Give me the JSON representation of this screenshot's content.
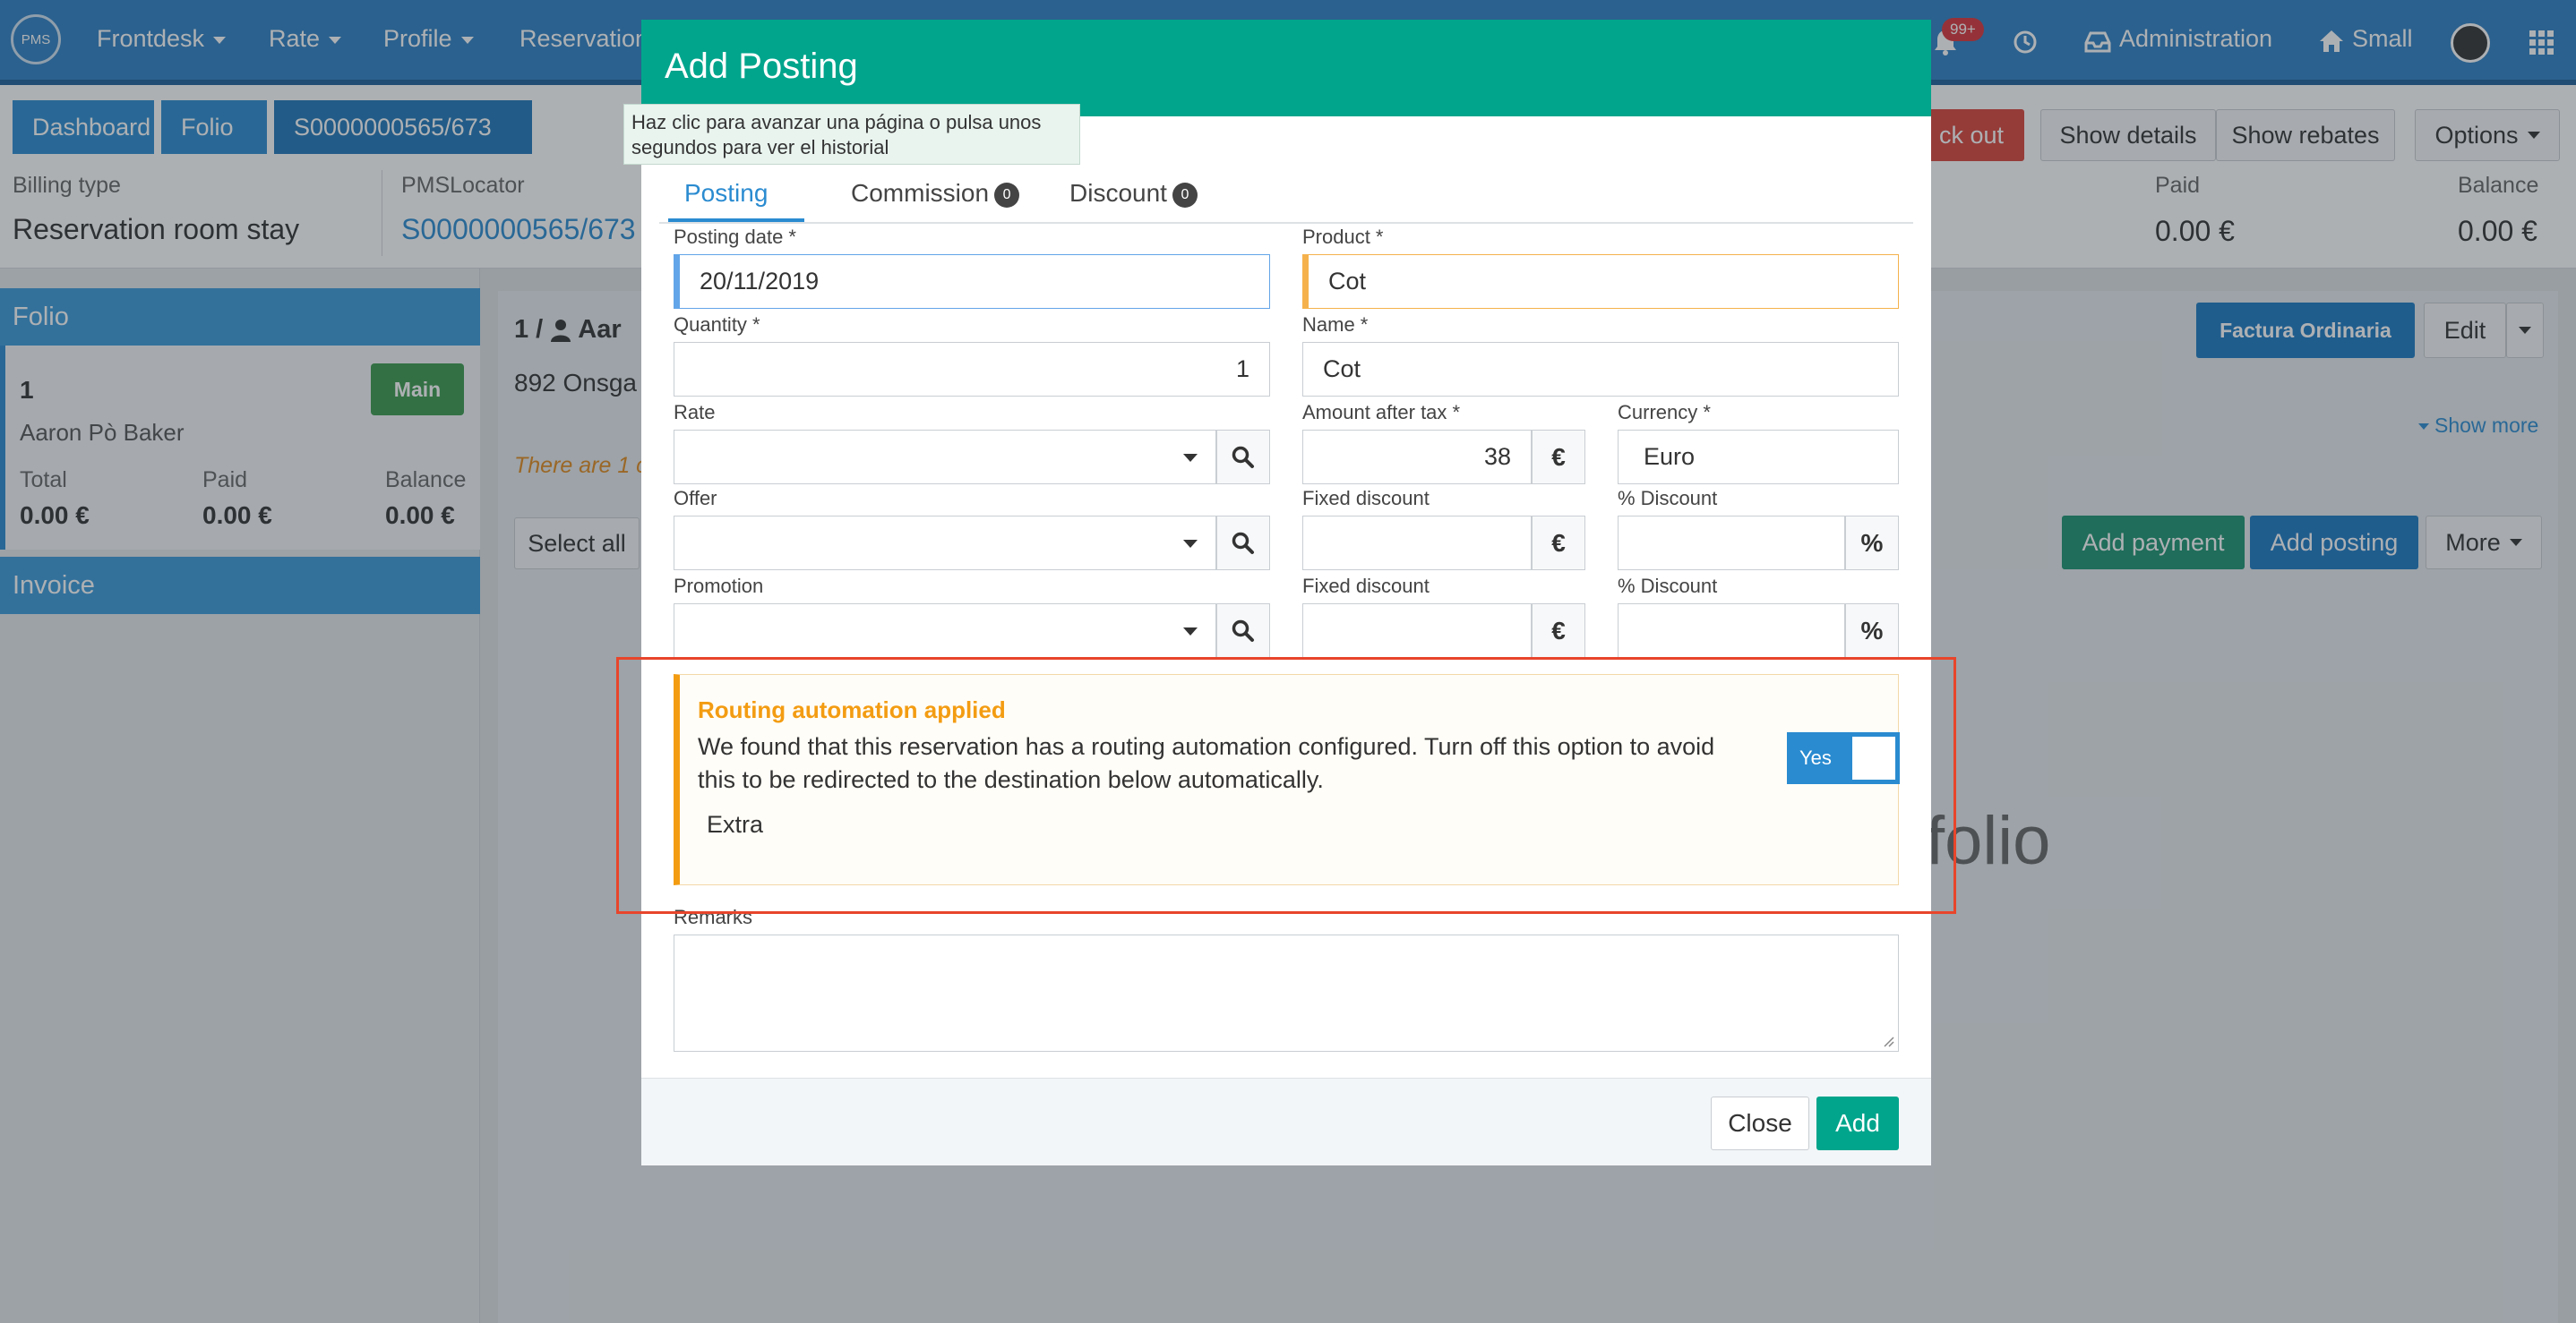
{
  "nav": {
    "logo_text": "PMS",
    "items": [
      {
        "label": "Frontdesk"
      },
      {
        "label": "Rate"
      },
      {
        "label": "Profile"
      },
      {
        "label": "Reservation"
      }
    ],
    "notifications_badge": "99+",
    "administration": "Administration",
    "small": "Small"
  },
  "breadcrumb": {
    "dashboard": "Dashboard",
    "folio": "Folio",
    "locator": "S0000000565/673"
  },
  "tooltip": "Haz clic para avanzar una página o pulsa unos segundos para ver el historial",
  "header_actions": {
    "checkout": "ck out",
    "show_details": "Show details",
    "show_rebates": "Show rebates",
    "options": "Options"
  },
  "billing": {
    "billing_type_label": "Billing type",
    "billing_type_value": "Reservation room stay",
    "pms_locator_label": "PMSLocator",
    "pms_locator_value": "S0000000565/673",
    "paid_label": "Paid",
    "paid_value": "0.00 €",
    "balance_label": "Balance",
    "balance_value": "0.00 €"
  },
  "sidebar": {
    "folio_header": "Folio",
    "folio_number": "1",
    "main_badge": "Main",
    "guest_name": "Aaron Pò Baker",
    "total_label": "Total",
    "total_value": "0.00 €",
    "paid_label": "Paid",
    "paid_value": "0.00 €",
    "balance_label": "Balance",
    "balance_value": "0.00 €",
    "invoice_header": "Invoice"
  },
  "main": {
    "folio_title": "1 / ",
    "guest_short": "Aar",
    "address_short": "892 Onsga",
    "warning_short": "There are 1 c",
    "factura_button": "Factura Ordinaria",
    "edit_button": "Edit",
    "show_more": "Show more",
    "select_all": "Select all",
    "add_payment": "Add payment",
    "add_posting": "Add posting",
    "more": "More",
    "empty_folio_text": "folio"
  },
  "modal": {
    "title": "Add Posting",
    "tabs": [
      {
        "label": "Posting",
        "count": ""
      },
      {
        "label": "Commission",
        "count": "0"
      },
      {
        "label": "Discount",
        "count": "0"
      }
    ],
    "posting_date_label": "Posting date *",
    "posting_date_value": "20/11/2019",
    "product_label": "Product *",
    "product_value": "Cot",
    "quantity_label": "Quantity *",
    "quantity_value": "1",
    "name_label": "Name *",
    "name_value": "Cot",
    "rate_label": "Rate",
    "amount_label": "Amount after tax *",
    "amount_value": "38",
    "currency_symbol": "€",
    "currency_label": "Currency *",
    "currency_value": "Euro",
    "offer_label": "Offer",
    "fixed_discount_label": "Fixed discount",
    "percent_discount_label": "% Discount",
    "percent_symbol": "%",
    "promotion_label": "Promotion",
    "routing": {
      "title": "Routing automation applied",
      "text": "We found that this reservation has a routing automation configured. Turn off this option to avoid this to be redirected to the destination below automatically.",
      "destination": "Extra",
      "toggle_label": "Yes",
      "toggle_on": true
    },
    "remarks_label": "Remarks",
    "close_button": "Close",
    "add_button": "Add"
  },
  "colors": {
    "nav": "#2e80c3",
    "modal_header": "#00a58c",
    "routing_accent": "#f39c12",
    "highlight_box": "#e8452b",
    "primary": "#2a8bd0"
  }
}
